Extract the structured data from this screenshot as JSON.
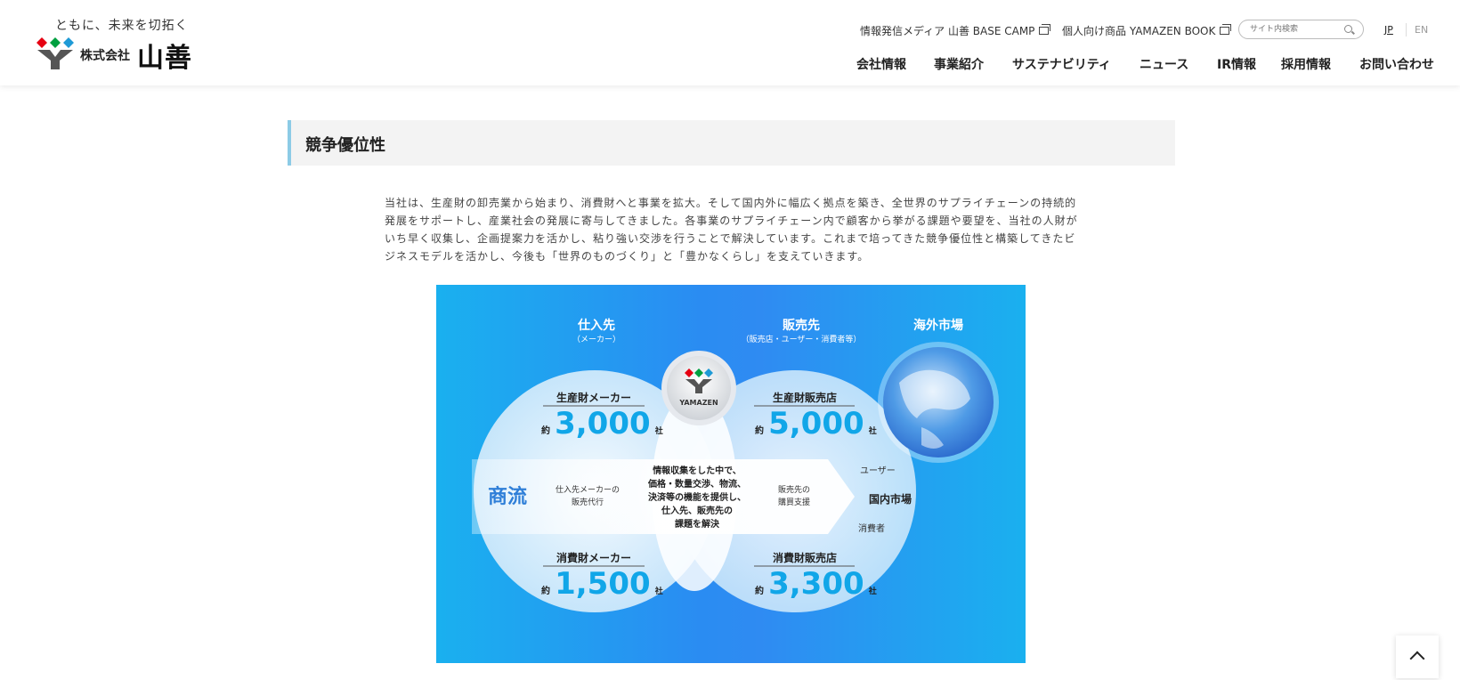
{
  "logo": {
    "tagline": "ともに、未来を切拓く",
    "corp_type": "株式会社",
    "name": "山善"
  },
  "utility": {
    "media_link": "情報発信メディア 山善 BASE CAMP",
    "book_link": "個人向け商品 YAMAZEN BOOK",
    "search_placeholder": "サイト内検索",
    "lang_jp": "JP",
    "lang_en": "EN"
  },
  "nav": {
    "items": [
      "会社情報",
      "事業紹介",
      "サステナビリティ",
      "ニュース",
      "IR情報",
      "採用情報",
      "お問い合わせ"
    ]
  },
  "section": {
    "title": "競争優位性",
    "body": "当社は、生産財の卸売業から始まり、消費財へと事業を拡大。そして国内外に幅広く拠点を築き、全世界のサプライチェーンの持続的発展をサポートし、産業社会の発展に寄与してきました。各事業のサプライチェーン内で顧客から挙がる課題や要望を、当社の人財がいち早く収集し、企画提案力を活かし、粘り強い交渉を行うことで解決しています。これまで培ってきた競争優位性と構築してきたビジネスモデルを活かし、今後も「世界のものづくり」と「豊かなくらし」を支えていきます。"
  },
  "diagram": {
    "supplier_title": "仕入先",
    "supplier_sub": "（メーカー）",
    "customer_title": "販売先",
    "customer_sub": "（販売店・ユーザー・消費者等）",
    "overseas": "海外市場",
    "logo_text": "YAMAZEN",
    "prod_maker": "生産財メーカー",
    "prod_maker_count": "3,000",
    "prod_dealer": "生産財販売店",
    "prod_dealer_count": "5,000",
    "cons_maker": "消費財メーカー",
    "cons_maker_count": "1,500",
    "cons_dealer": "消費財販売店",
    "cons_dealer_count": "3,300",
    "approx": "約",
    "unit": "社",
    "commerce": "商流",
    "left_note_1": "仕入先メーカーの",
    "left_note_2": "販売代行",
    "center_1": "情報収集をした中で、",
    "center_2": "価格・数量交渉、物流、",
    "center_3": "決済等の機能を提供し、",
    "center_4": "仕入先、販売先の",
    "center_5": "課題を解決",
    "right_note_1": "販売先の",
    "right_note_2": "購買支援",
    "user": "ユーザー",
    "domestic": "国内市場",
    "consumer": "消費者"
  },
  "colors": {
    "diagram_blue": "#1ab0ef",
    "count_blue": "#11a6e8",
    "accent_bar": "#8ccbe6"
  }
}
